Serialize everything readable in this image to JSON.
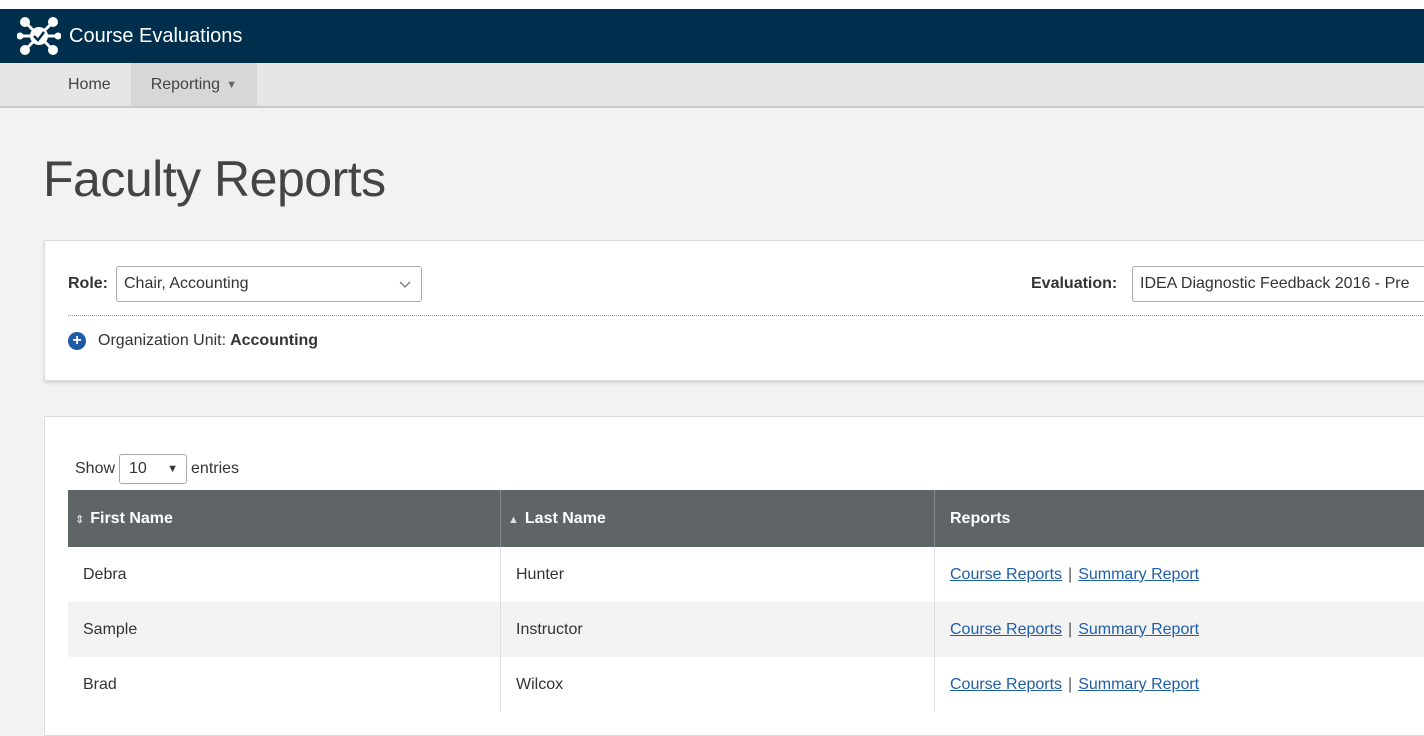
{
  "header": {
    "app_title": "Course Evaluations"
  },
  "nav": {
    "items": [
      {
        "label": "Home"
      },
      {
        "label": "Reporting",
        "caret": "▼"
      }
    ]
  },
  "page": {
    "title": "Faculty Reports"
  },
  "filters": {
    "role_label": "Role:",
    "role_value": "Chair, Accounting",
    "evaluation_label": "Evaluation:",
    "evaluation_value": "IDEA Diagnostic Feedback 2016 - Pre",
    "org_label": "Organization Unit:",
    "org_value": "Accounting"
  },
  "table_controls": {
    "show_label": "Show",
    "page_length": "10",
    "entries_label": "entries"
  },
  "table": {
    "columns": [
      {
        "label": "First Name",
        "sort": "⇕"
      },
      {
        "label": "Last Name",
        "sort": "▲"
      },
      {
        "label": "Reports"
      }
    ],
    "rows": [
      {
        "first": "Debra",
        "last": "Hunter",
        "course_link": "Course Reports",
        "summary_link": "Summary Report"
      },
      {
        "first": "Sample",
        "last": "Instructor",
        "course_link": "Course Reports",
        "summary_link": "Summary Report"
      },
      {
        "first": "Brad",
        "last": "Wilcox",
        "course_link": "Course Reports",
        "summary_link": "Summary Report"
      }
    ],
    "link_separator": "|"
  },
  "colors": {
    "header_bg": "#002f4d",
    "table_header_bg": "#5f6567",
    "link": "#1f5fa8",
    "plus_icon": "#1e5aa8"
  }
}
